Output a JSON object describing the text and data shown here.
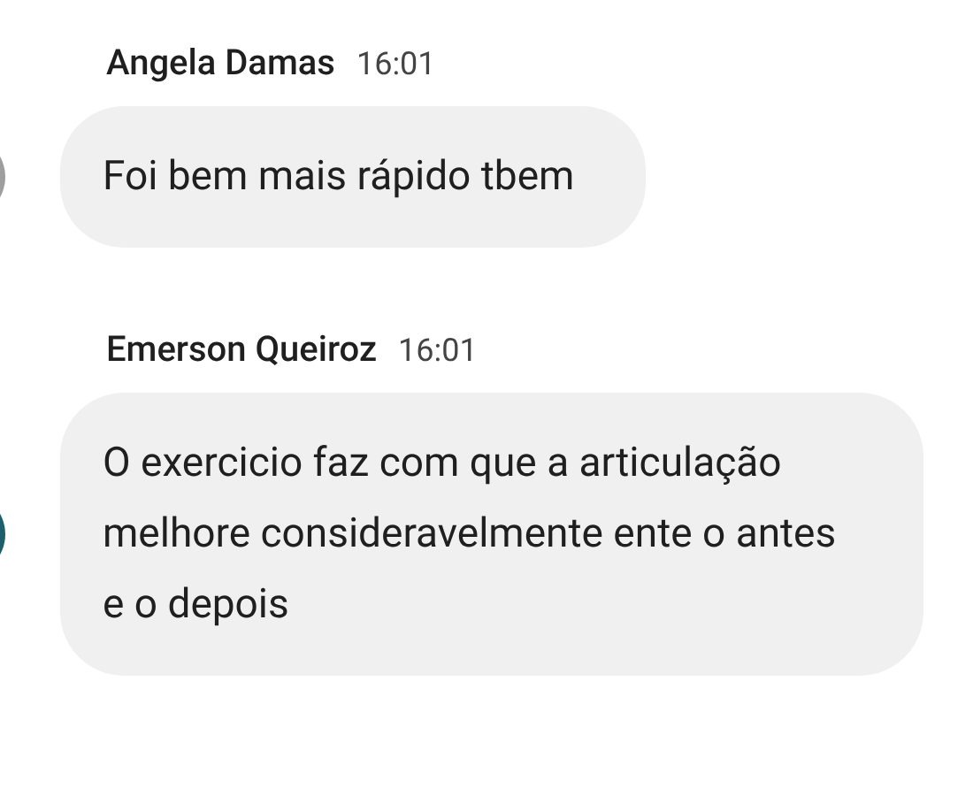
{
  "messages": [
    {
      "sender": "Angela Damas",
      "time": "16:01",
      "color": "#9e9e9e",
      "text": "Foi bem mais rápido tbem"
    },
    {
      "sender": "Emerson Queiroz",
      "time": "16:01",
      "color": "#1f5f6b",
      "text": "O exercicio faz com que a articulação melhore consideravelmente ente o antes e o depois"
    }
  ]
}
